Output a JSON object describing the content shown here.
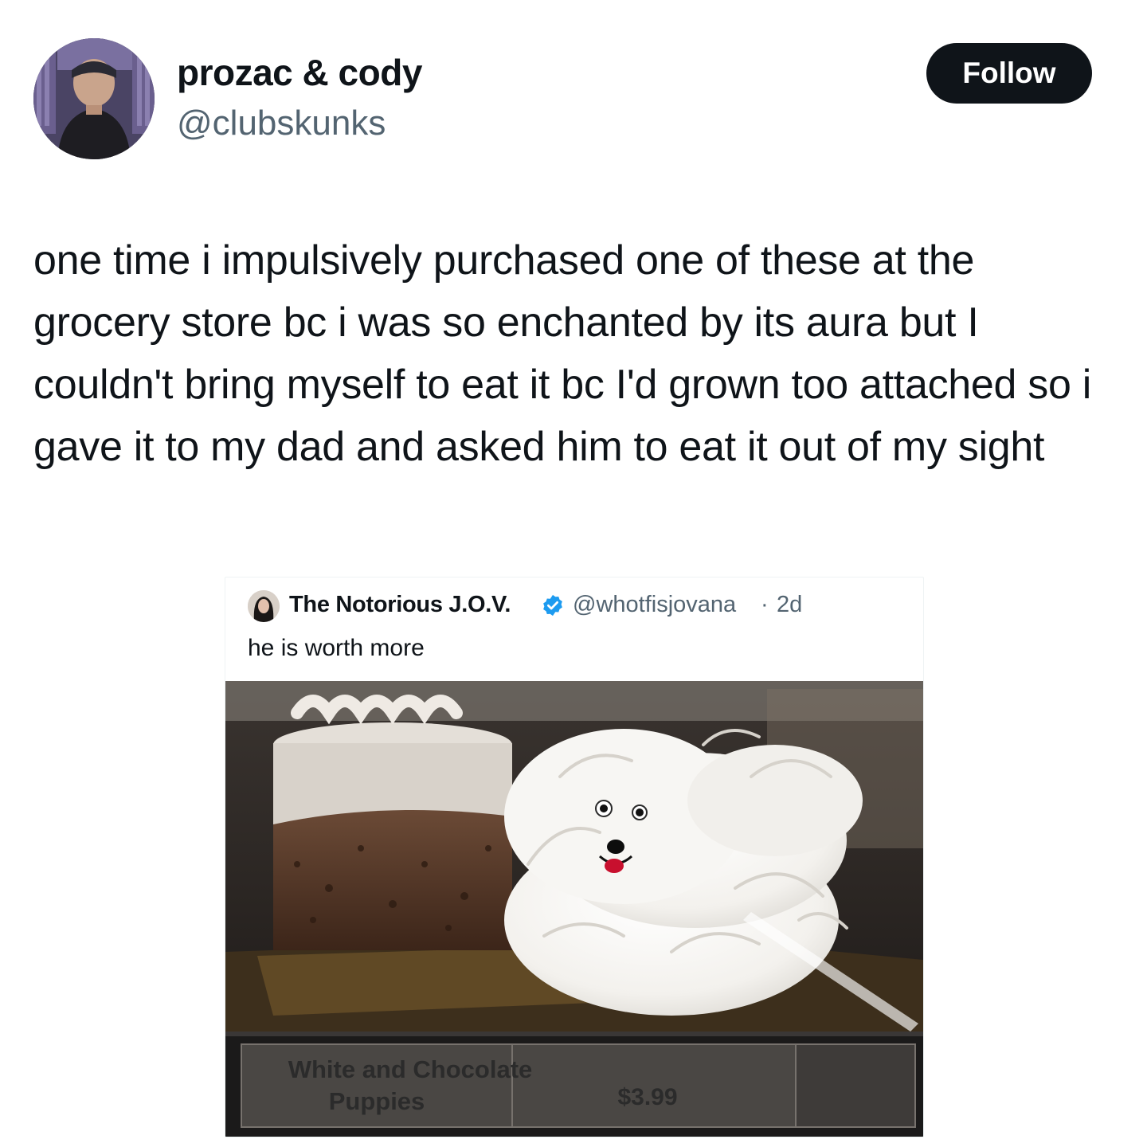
{
  "author": {
    "display_name": "prozac & cody",
    "handle": "@clubskunks",
    "avatar_icon": "profile-photo-icon"
  },
  "follow_label": "Follow",
  "tweet_text": "one time i impulsively purchased one of these at the grocery store bc i was so enchanted by its aura but I couldn't bring myself to eat it bc I'd grown too attached so i gave it to my dad and asked him to eat it out of my sight",
  "quoted_tweet": {
    "display_name": "The Notorious J.O.V.",
    "verified_icon": "verified-badge-icon",
    "handle": "@whotfisjovana",
    "separator": "·",
    "time": "2d",
    "text": "he is worth more",
    "photo": {
      "price_label": {
        "name_line1": "White and Chocolate",
        "name_line2": "Puppies",
        "price": "$3.99"
      }
    }
  },
  "colors": {
    "text": "#0f1419",
    "secondary": "#536471",
    "button": "#0f1419",
    "verified": "#1d9bf0"
  }
}
